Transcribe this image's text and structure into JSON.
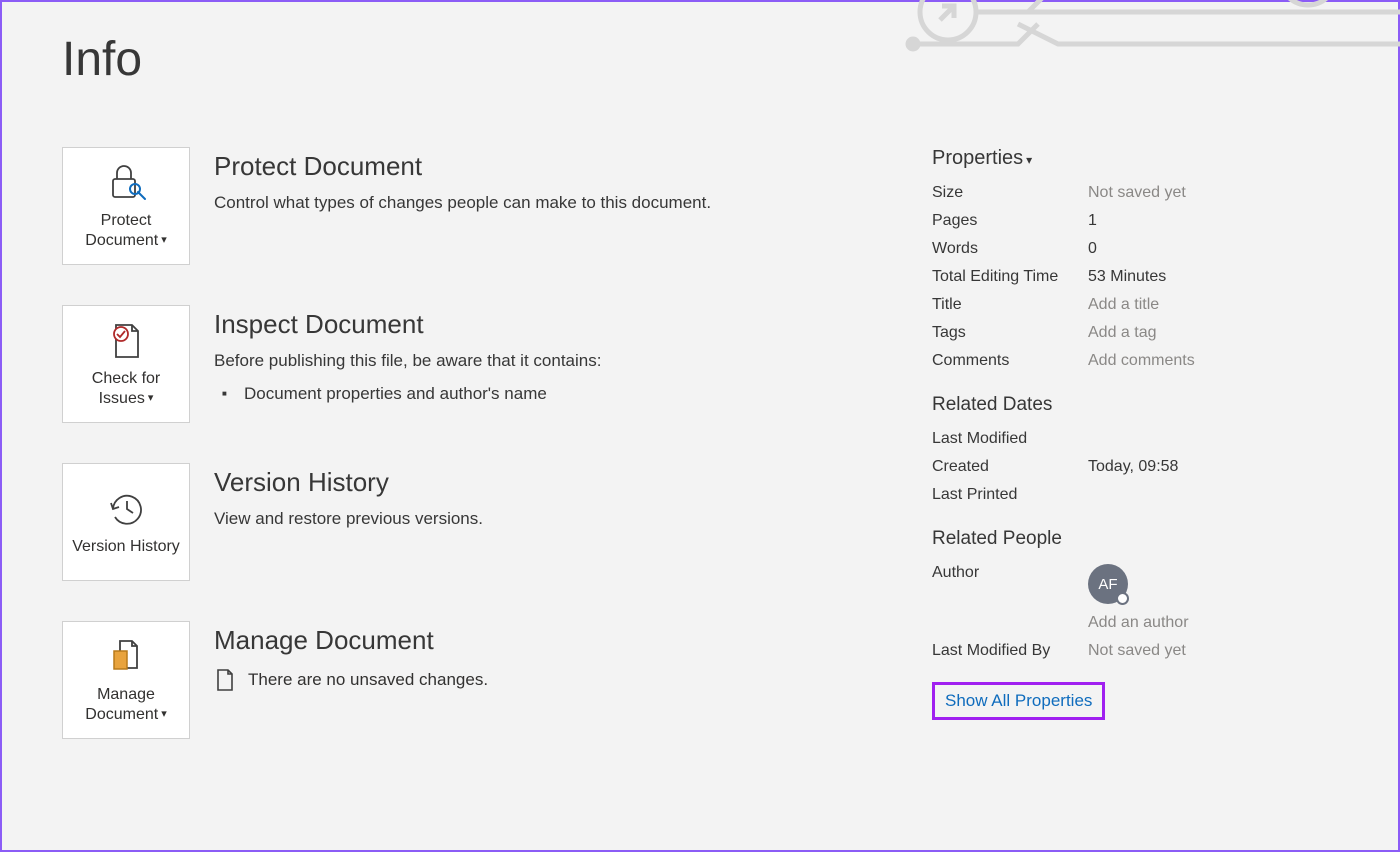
{
  "page_title": "Info",
  "sections": {
    "protect": {
      "button": "Protect Document",
      "heading": "Protect Document",
      "desc": "Control what types of changes people can make to this document."
    },
    "inspect": {
      "button": "Check for Issues",
      "heading": "Inspect Document",
      "desc": "Before publishing this file, be aware that it contains:",
      "item1": "Document properties and author's name"
    },
    "version": {
      "button": "Version History",
      "heading": "Version History",
      "desc": "View and restore previous versions."
    },
    "manage": {
      "button": "Manage Document",
      "heading": "Manage Document",
      "desc": "There are no unsaved changes."
    }
  },
  "properties": {
    "header": "Properties",
    "size_label": "Size",
    "size_value": "Not saved yet",
    "pages_label": "Pages",
    "pages_value": "1",
    "words_label": "Words",
    "words_value": "0",
    "editing_label": "Total Editing Time",
    "editing_value": "53 Minutes",
    "title_label": "Title",
    "title_value": "Add a title",
    "tags_label": "Tags",
    "tags_value": "Add a tag",
    "comments_label": "Comments",
    "comments_value": "Add comments"
  },
  "dates": {
    "header": "Related Dates",
    "modified_label": "Last Modified",
    "modified_value": "",
    "created_label": "Created",
    "created_value": "Today, 09:58",
    "printed_label": "Last Printed",
    "printed_value": ""
  },
  "people": {
    "header": "Related People",
    "author_label": "Author",
    "author_initials": "AF",
    "add_author": "Add an author",
    "modified_by_label": "Last Modified By",
    "modified_by_value": "Not saved yet"
  },
  "show_all": "Show All Properties"
}
